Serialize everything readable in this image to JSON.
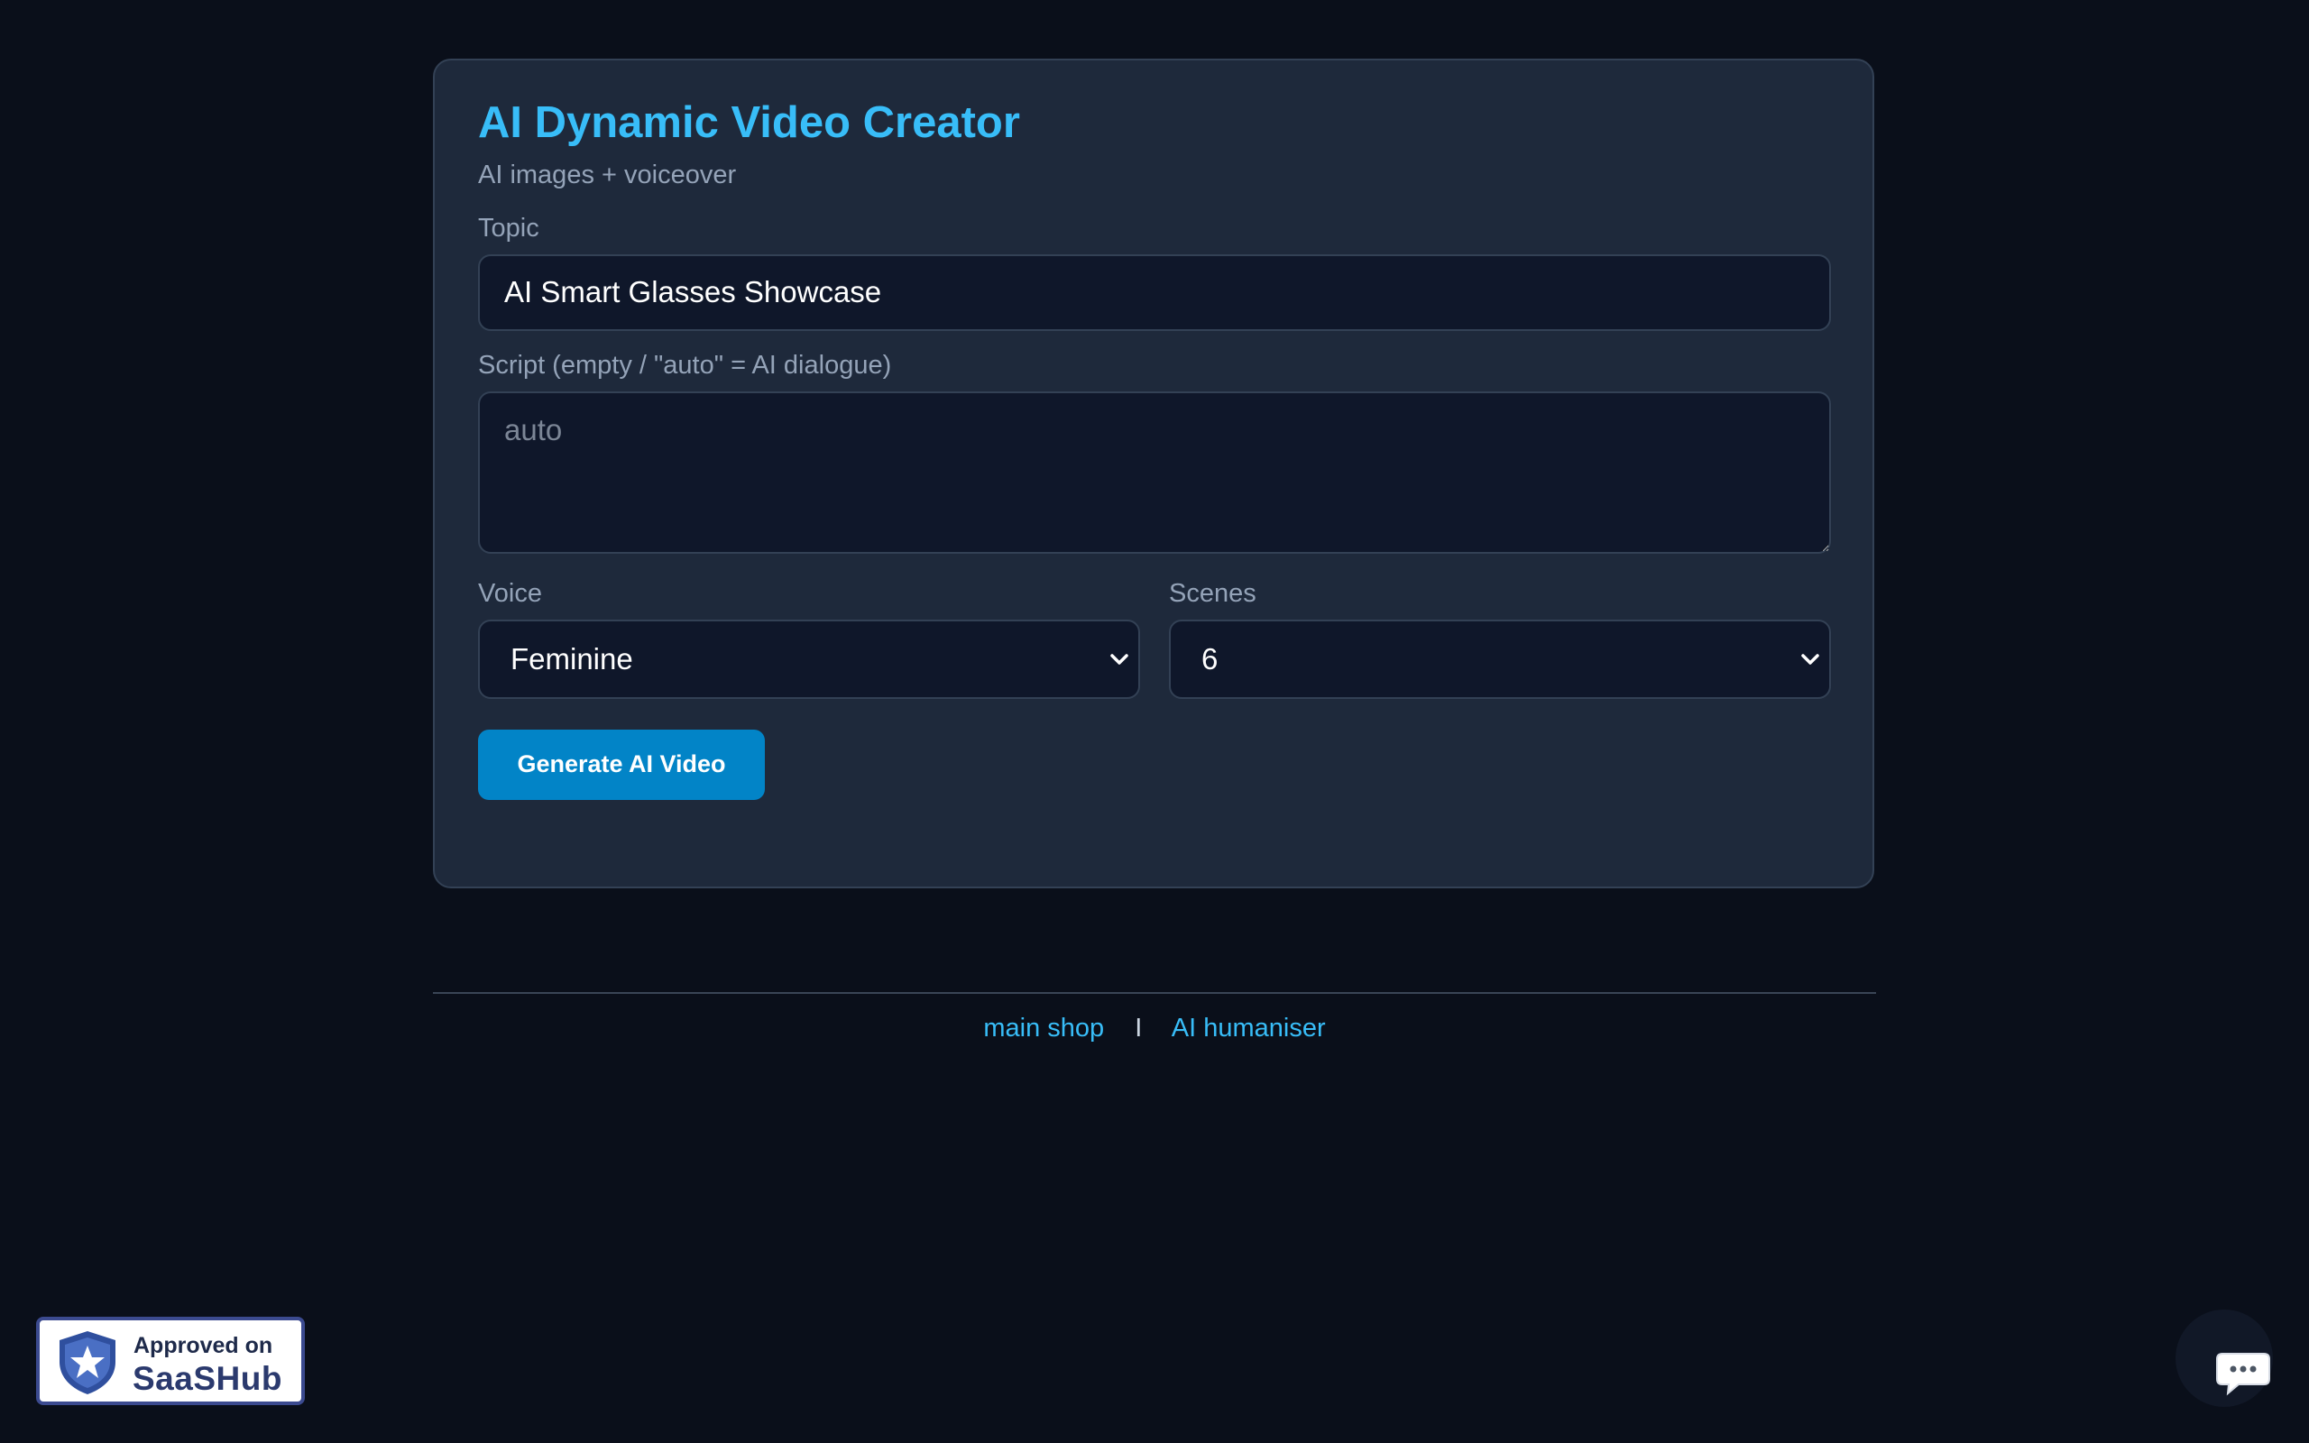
{
  "header": {
    "title": "AI Dynamic Video Creator",
    "subtitle": "AI images + voiceover"
  },
  "form": {
    "topic_label": "Topic",
    "topic_value": "AI Smart Glasses Showcase",
    "script_label": "Script (empty / \"auto\" = AI dialogue)",
    "script_placeholder": "auto",
    "voice_label": "Voice",
    "voice_value": "Feminine",
    "scenes_label": "Scenes",
    "scenes_value": "6",
    "generate_label": "Generate AI Video"
  },
  "footer": {
    "links": [
      {
        "label": "main shop"
      },
      {
        "label": "AI humaniser"
      }
    ],
    "separator": "I"
  },
  "badge": {
    "line1": "Approved on",
    "line2": "SaaSHub"
  },
  "icons": {
    "chat": "chat-bubble-icon",
    "shield": "shield-star-icon",
    "chevron": "chevron-down-icon"
  },
  "colors": {
    "background": "#0a0f1a",
    "card": "#1e293b",
    "accent": "#38bdf8",
    "button": "#0284c7",
    "input_bg": "#0f172a"
  }
}
